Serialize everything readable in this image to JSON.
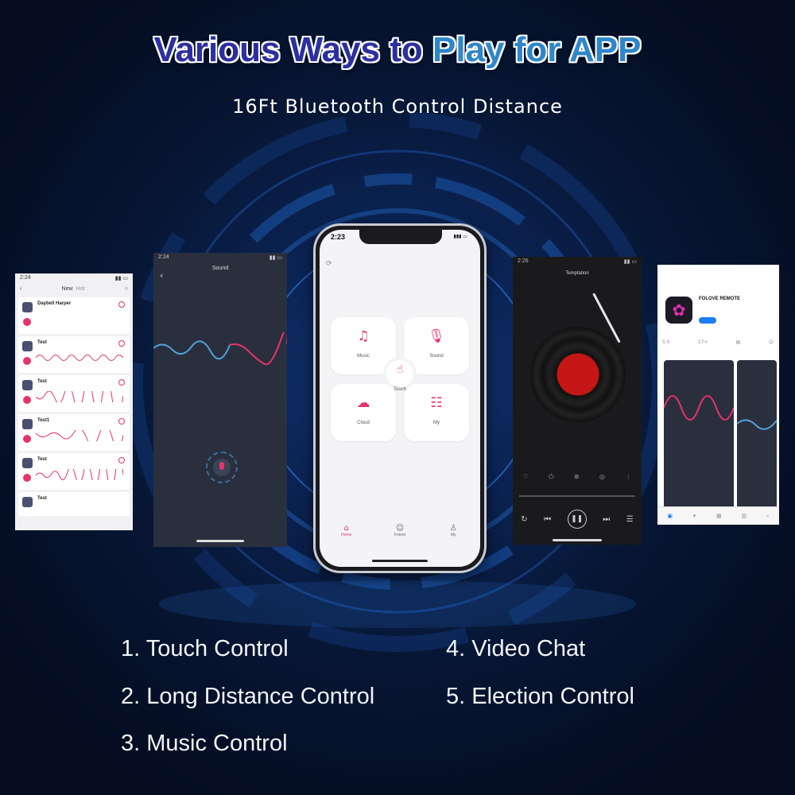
{
  "headline": {
    "part1": "Various Ways to ",
    "part2": "Play for APP"
  },
  "subheadline": "16Ft Bluetooth Control Distance",
  "phone_main": {
    "time": "2:23",
    "tiles": [
      {
        "label": "Music",
        "icon": "music-note-icon"
      },
      {
        "label": "Sound",
        "icon": "microphone-icon"
      },
      {
        "label": "Cloud",
        "icon": "cloud-icon"
      },
      {
        "label": "My",
        "icon": "sliders-icon"
      }
    ],
    "center_label": "Touch",
    "tabs": [
      {
        "label": "Home",
        "icon": "home-icon"
      },
      {
        "label": "Friend",
        "icon": "friend-icon"
      },
      {
        "label": "My",
        "icon": "profile-icon"
      }
    ]
  },
  "screen_list": {
    "time": "2:24",
    "tabs": [
      "New",
      "Hot"
    ],
    "items": [
      {
        "name": "Daybell Harper"
      },
      {
        "name": "Test"
      },
      {
        "name": "Test"
      },
      {
        "name": "Test1"
      },
      {
        "name": "Test"
      },
      {
        "name": "Test"
      }
    ]
  },
  "screen_sound": {
    "time": "2:24",
    "title": "Sound"
  },
  "screen_music": {
    "time": "2:26",
    "title": "Temptation"
  },
  "screen_store": {
    "app_name": "FOLOVE REMOTE",
    "rating": "5.0",
    "age": "17+"
  },
  "features": [
    "1. Touch Control",
    "2. Long Distance Control",
    "3. Music Control",
    "4. Video Chat",
    "5. Election Control"
  ],
  "colors": {
    "accent": "#e6336b",
    "title_dark": "#2b2f9f",
    "title_light": "#2f86c9",
    "background": "#071634"
  }
}
